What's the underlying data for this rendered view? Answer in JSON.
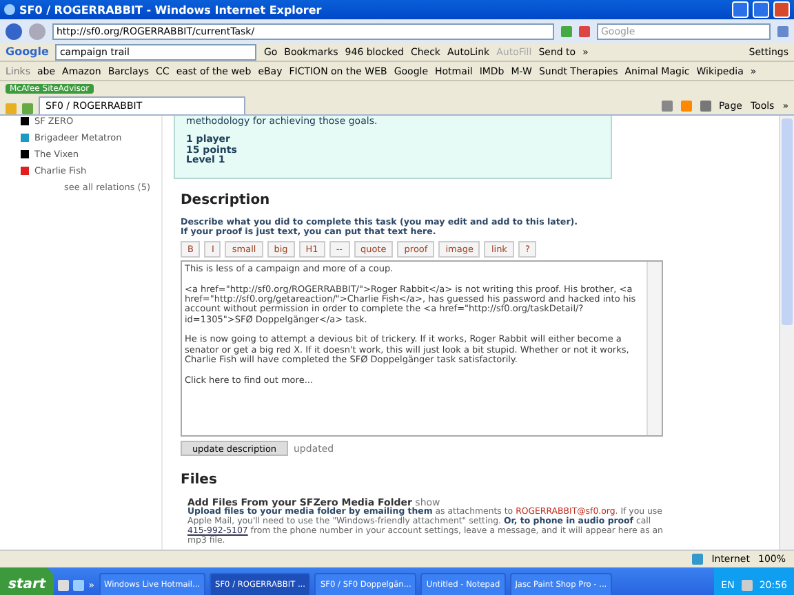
{
  "window": {
    "title": "SF0 / ROGERRABBIT - Windows Internet Explorer"
  },
  "address_bar": {
    "url": "http://sf0.org/ROGERRABBIT/currentTask/",
    "search_placeholder": "Google"
  },
  "google_toolbar": {
    "logo": "Google",
    "query": "campaign trail",
    "go": "Go",
    "items": [
      {
        "label": "Bookmarks",
        "disabled": false
      },
      {
        "label": "946 blocked",
        "disabled": false
      },
      {
        "label": "Check",
        "disabled": false
      },
      {
        "label": "AutoLink",
        "disabled": false
      },
      {
        "label": "AutoFill",
        "disabled": true
      },
      {
        "label": "Send to",
        "disabled": false
      }
    ],
    "more": "»",
    "settings": "Settings"
  },
  "links_bar": {
    "label": "Links",
    "items": [
      "abe",
      "Amazon",
      "Barclays",
      "CC",
      "east of the web",
      "eBay",
      "FICTION on the WEB",
      "Google",
      "Hotmail",
      "IMDb",
      "M-W",
      "Sundt Therapies",
      "Animal Magic",
      "Wikipedia"
    ],
    "more": "»"
  },
  "mcafee": {
    "label": "McAfee SiteAdvisor"
  },
  "tabs": [
    {
      "label": "SF0 / ROGERRABBIT",
      "selected": true
    }
  ],
  "command_bar": {
    "items": [
      "Page",
      "Tools"
    ],
    "more": "»"
  },
  "sidebar": {
    "relations": [
      {
        "name": "SF ZERO",
        "color": "#000000"
      },
      {
        "name": "Brigadeer Metatron",
        "color": "#1b9bc4"
      },
      {
        "name": "The Vixen",
        "color": "#000000"
      },
      {
        "name": "Charlie Fish",
        "color": "#e02020"
      }
    ],
    "see_all": "see all relations (5)"
  },
  "task": {
    "text": "methodology for achieving those goals.",
    "stats": [
      "1 player",
      "15 points",
      "Level 1"
    ]
  },
  "description": {
    "heading": "Description",
    "instructions": [
      "Describe what you did to complete this task (you may edit and add to this later).",
      "If your proof is just text, you can put that text here."
    ],
    "toolbar": [
      "B",
      "I",
      "small",
      "big",
      "H1",
      "--",
      "quote",
      "proof",
      "image",
      "link",
      "?"
    ],
    "paragraphs": [
      "This is less of a campaign and more of a coup.",
      "<a href=\"http://sf0.org/ROGERRABBIT/\">Roger Rabbit</a> is not writing this proof. His brother, <a href=\"http://sf0.org/getareaction/\">Charlie Fish</a>, has guessed his password and hacked into his account without permission in order to complete the <a href=\"http://sf0.org/taskDetail/?id=1305\">SFØ Doppelgänger</a> task.",
      "He is now going to attempt a devious bit of trickery. If it works, Roger Rabbit will either become a senator or get a big red X. If it doesn't work, this will just look a bit stupid. Whether or not it works, Charlie Fish will have completed the SFØ Doppelgänger task satisfactorily.",
      "Click here to find out more..."
    ],
    "button": "update description",
    "status": "updated"
  },
  "files": {
    "heading": "Files",
    "title": "Add Files From your SFZero Media Folder",
    "show": "show",
    "segments": [
      {
        "kind": "bold",
        "text": "Upload files to your media folder by emailing them"
      },
      {
        "kind": "plain",
        "text": " as attachments to "
      },
      {
        "kind": "link",
        "text": "ROGERRABBIT@sf0.org"
      },
      {
        "kind": "plain",
        "text": ". If you use Apple Mail, you'll need to use the \"Windows-friendly attachment\" setting. "
      },
      {
        "kind": "bold",
        "text": "Or, to phone in audio proof"
      },
      {
        "kind": "plain",
        "text": " call "
      },
      {
        "kind": "link",
        "text": "415-992-5107"
      },
      {
        "kind": "plain",
        "text": " from the phone number in your account settings, leave a message, and it will appear here as an mp3 file."
      }
    ]
  },
  "status_bar": {
    "zone": "Internet",
    "zoom": "100%"
  },
  "taskbar": {
    "start": "start",
    "more": "»",
    "windows": [
      {
        "label": "Windows Live Hotmail...",
        "selected": false
      },
      {
        "label": "SF0 / ROGERRABBIT ...",
        "selected": true
      },
      {
        "label": "SF0 / SF0 Doppelgän...",
        "selected": false
      },
      {
        "label": "Untitled - Notepad",
        "selected": false
      },
      {
        "label": "Jasc Paint Shop Pro - ...",
        "selected": false
      }
    ],
    "language": "EN",
    "clock": "20:56"
  }
}
